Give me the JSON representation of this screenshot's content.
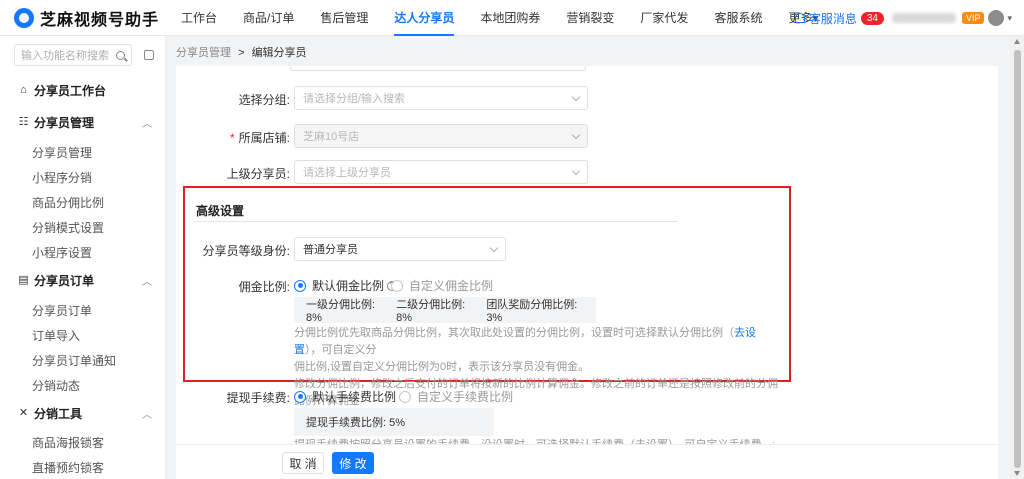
{
  "app": {
    "title": "芝麻视频号助手"
  },
  "nav": {
    "items": [
      "工作台",
      "商品/订单",
      "售后管理",
      "达人分享员",
      "本地团购券",
      "营销裂变",
      "厂家代发",
      "客服系统",
      "更多▾"
    ],
    "active_index": 3,
    "service_label": "客服消息",
    "service_count": "34",
    "vip_label": "VIP"
  },
  "sidebar": {
    "search_placeholder": "输入功能名称搜索",
    "workbench": "分享员工作台",
    "sections": [
      {
        "title": "分享员管理",
        "items": [
          "分享员管理",
          "小程序分销",
          "商品分佣比例",
          "分销模式设置",
          "小程序设置"
        ]
      },
      {
        "title": "分享员订单",
        "items": [
          "分享员订单",
          "订单导入",
          "分享员订单通知",
          "分销动态"
        ]
      },
      {
        "title": "分销工具",
        "items": [
          "商品海报锁客",
          "直播预约锁客"
        ]
      }
    ]
  },
  "breadcrumb": {
    "parent": "分享员管理",
    "sep": ">",
    "current": "编辑分享员"
  },
  "form": {
    "group": {
      "label": "选择分组:",
      "placeholder": "请选择分组/输入搜索"
    },
    "store": {
      "label": "所属店铺:",
      "value": "芝麻10号店",
      "required_mark": "*"
    },
    "parent": {
      "label": "上级分享员:",
      "placeholder": "请选择上级分享员"
    },
    "advanced": {
      "title": "高级设置",
      "level": {
        "label": "分享员等级身份:",
        "value": "普通分享员"
      },
      "commission": {
        "label": "佣金比例:",
        "opt_default": "默认佣金比例",
        "opt_custom": "自定义佣金比例",
        "rate1": "一级分佣比例: 8%",
        "rate2": "二级分佣比例: 8%",
        "rate3": "团队奖励分佣比例: 3%",
        "note1a": "分佣比例优先取商品分佣比例，其次取此处设置的分佣比例，设置时可选择默认分佣比例（",
        "note1_link": "去设置",
        "note1b": "），可自定义分",
        "note2": "佣比例,设置自定义分佣比例为0时，表示该分享员没有佣金。",
        "note3": "修改分佣比例，修改之后支付的订单将按新的比例计算佣金。修改之前的订单还是按照修改前的分佣比例计算佣金"
      }
    },
    "withdraw": {
      "label": "提现手续费:",
      "opt_default": "默认手续费比例",
      "opt_custom": "自定义手续费比例",
      "rate": "提现手续费比例: 5%",
      "note_partial": "提现手续费按照分享员设置的手续费，没设置时，可选择默认手续费（去设置），可自定义手续费，设置为自定义手"
    }
  },
  "footer": {
    "cancel": "取 消",
    "submit": "修 改"
  },
  "colors": {
    "primary": "#1677ff",
    "highlight": "#e02020"
  }
}
